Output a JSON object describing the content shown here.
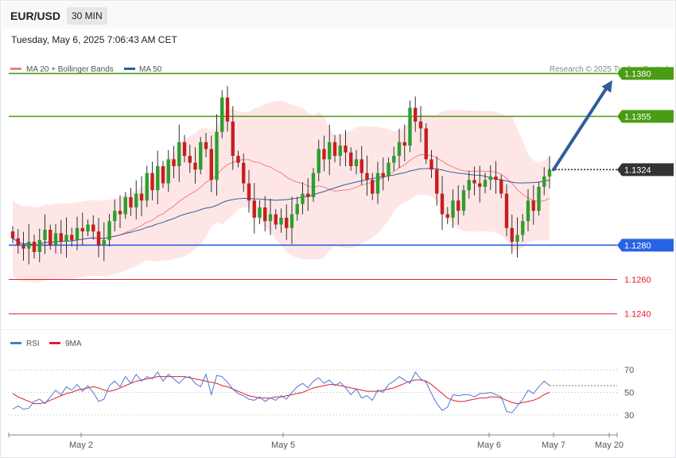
{
  "header": {
    "symbol": "EUR/USD",
    "timeframe": "30 MIN"
  },
  "timestamp": "Tuesday, May 6, 2025 7:06:43 AM CET",
  "legend": [
    {
      "label": "MA 20 + Bollinger Bands",
      "color": "#f08080"
    },
    {
      "label": "MA 50",
      "color": "#2f5d9a"
    }
  ],
  "credit": "Research © 2025 Trading Central",
  "rsi_legend": [
    {
      "label": "RSI",
      "color": "#4a78d4"
    },
    {
      "label": "9MA",
      "color": "#e0202a"
    }
  ],
  "chart_data": [
    {
      "type": "candlestick",
      "ylim": [
        1.1232,
        1.1395
      ],
      "levels": [
        {
          "value": 1.138,
          "label": "1.1380",
          "color": "#4a9c12",
          "style": "resistance"
        },
        {
          "value": 1.1355,
          "label": "1.1355",
          "color": "#4a9c12",
          "style": "resistance"
        },
        {
          "value": 1.1324,
          "label": "1.1324",
          "color": "#333333",
          "style": "current"
        },
        {
          "value": 1.128,
          "label": "1.1280",
          "color": "#2a62e6",
          "style": "pivot"
        },
        {
          "value": 1.126,
          "label": "1.1260",
          "color": "#e0202a",
          "style": "support"
        },
        {
          "value": 1.124,
          "label": "1.1240",
          "color": "#e0202a",
          "style": "support"
        }
      ],
      "projection_target": 1.1376,
      "x_axis": [
        "May 2",
        "May 5",
        "May 6",
        "May 7",
        "May 20"
      ],
      "closes": [
        1.1284,
        1.128,
        1.1278,
        1.1282,
        1.1276,
        1.1283,
        1.1289,
        1.128,
        1.1287,
        1.1282,
        1.1286,
        1.1283,
        1.129,
        1.1288,
        1.1292,
        1.1288,
        1.128,
        1.1283,
        1.1294,
        1.13,
        1.1298,
        1.1308,
        1.1302,
        1.131,
        1.1306,
        1.1322,
        1.1312,
        1.1326,
        1.1316,
        1.133,
        1.1326,
        1.134,
        1.1332,
        1.1328,
        1.1324,
        1.134,
        1.1336,
        1.1318,
        1.1346,
        1.1366,
        1.1352,
        1.1332,
        1.1328,
        1.1316,
        1.1306,
        1.1296,
        1.1302,
        1.1294,
        1.1298,
        1.1292,
        1.1296,
        1.129,
        1.1298,
        1.1304,
        1.131,
        1.1308,
        1.1322,
        1.1336,
        1.133,
        1.134,
        1.1332,
        1.1338,
        1.1334,
        1.1326,
        1.133,
        1.1322,
        1.1318,
        1.131,
        1.1322,
        1.132,
        1.1328,
        1.1332,
        1.134,
        1.1338,
        1.136,
        1.1352,
        1.1348,
        1.133,
        1.1324,
        1.131,
        1.1298,
        1.1296,
        1.1306,
        1.13,
        1.1312,
        1.1318,
        1.1316,
        1.1314,
        1.1318,
        1.132,
        1.1318,
        1.131,
        1.129,
        1.1282,
        1.1286,
        1.1294,
        1.1306,
        1.13,
        1.1314,
        1.132,
        1.1324
      ]
    },
    {
      "type": "line",
      "title": "RSI",
      "ylim": [
        20,
        80
      ],
      "gridlines": [
        70,
        50,
        30
      ],
      "series": [
        {
          "name": "RSI",
          "values": [
            35,
            38,
            35,
            36,
            42,
            44,
            40,
            46,
            52,
            48,
            55,
            52,
            57,
            51,
            56,
            50,
            42,
            44,
            56,
            60,
            55,
            64,
            58,
            66,
            60,
            64,
            62,
            68,
            60,
            66,
            62,
            58,
            63,
            64,
            58,
            55,
            66,
            48,
            65,
            64,
            59,
            53,
            49,
            47,
            44,
            43,
            46,
            42,
            45,
            43,
            47,
            44,
            50,
            55,
            58,
            54,
            60,
            63,
            58,
            61,
            56,
            59,
            54,
            48,
            53,
            45,
            47,
            43,
            52,
            50,
            57,
            60,
            64,
            61,
            58,
            68,
            62,
            59,
            49,
            40,
            34,
            37,
            48,
            47,
            48,
            48,
            46,
            49,
            49,
            50,
            48,
            46,
            33,
            32,
            38,
            44,
            52,
            49,
            55,
            60,
            56
          ]
        },
        {
          "name": "9MA",
          "values": [
            49,
            46,
            44,
            42,
            40,
            40,
            41,
            43,
            45,
            47,
            49,
            50,
            52,
            53,
            54,
            55,
            54,
            52,
            51,
            52,
            54,
            56,
            58,
            60,
            61,
            62,
            63,
            64,
            64,
            64,
            64,
            64,
            64,
            63,
            62,
            61,
            60,
            59,
            58,
            56,
            55,
            53,
            51,
            49,
            47,
            46,
            45,
            45,
            45,
            46,
            46,
            47,
            48,
            49,
            50,
            52,
            54,
            55,
            56,
            57,
            57,
            56,
            55,
            54,
            53,
            52,
            51,
            51,
            51,
            52,
            53,
            54,
            56,
            58,
            60,
            61,
            61,
            60,
            57,
            53,
            49,
            45,
            43,
            42,
            42,
            43,
            44,
            45,
            45,
            46,
            46,
            45,
            43,
            41,
            40,
            41,
            42,
            43,
            45,
            48,
            50
          ]
        }
      ]
    }
  ]
}
